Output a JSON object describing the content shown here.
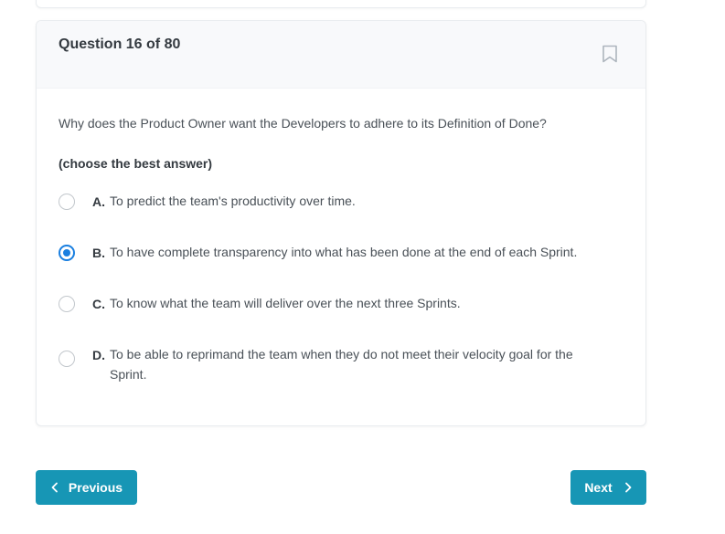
{
  "question": {
    "title": "Question 16 of 80",
    "text": "Why does the Product Owner want the Developers to adhere to its Definition of Done?",
    "hint": "(choose the best answer)",
    "options": [
      {
        "letter": "A.",
        "text": "To predict the team's productivity over time.",
        "selected": false
      },
      {
        "letter": "B.",
        "text": "To have complete transparency into what has been done at the end of each Sprint.",
        "selected": true
      },
      {
        "letter": "C.",
        "text": "To know what the team will deliver over the next three Sprints.",
        "selected": false
      },
      {
        "letter": "D.",
        "text": "To be able to reprimand the team when they do not meet their velocity goal for the Sprint.",
        "selected": false
      }
    ]
  },
  "nav": {
    "previous_label": "Previous",
    "next_label": "Next"
  },
  "colors": {
    "accent": "#1a7fe0",
    "button": "#1796b5"
  },
  "icons": {
    "bookmark": "bookmark-icon",
    "previous": "chevron-left-icon",
    "next": "chevron-right-icon"
  }
}
